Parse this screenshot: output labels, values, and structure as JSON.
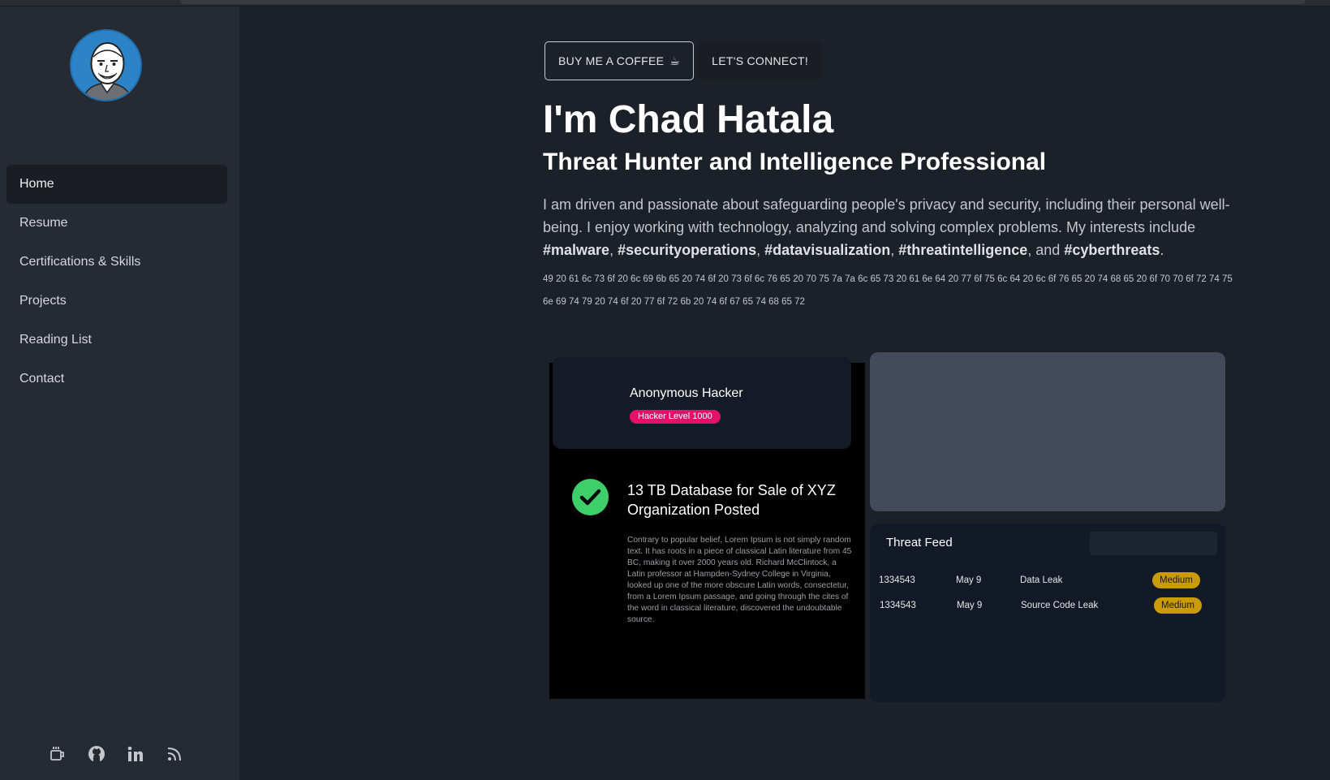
{
  "sidebar": {
    "nav": [
      {
        "label": "Home",
        "active": true
      },
      {
        "label": "Resume"
      },
      {
        "label": "Certifications & Skills"
      },
      {
        "label": "Projects"
      },
      {
        "label": "Reading List"
      },
      {
        "label": "Contact"
      }
    ],
    "social_icons": [
      "coffee-cup-icon",
      "github-icon",
      "linkedin-icon",
      "rss-icon"
    ]
  },
  "header": {
    "coffee_button": "BUY ME A COFFEE",
    "coffee_emoji": "☕",
    "connect_button": "LET'S CONNECT!"
  },
  "hero": {
    "name": "I'm Chad Hatala",
    "role": "Threat Hunter and Intelligence Professional",
    "bio_text": "I am driven and passionate about safeguarding people's privacy and security, including their personal well-being. I enjoy working with technology, analyzing and solving complex problems. My interests include",
    "tags": [
      "#malware",
      "#securityoperations",
      "#datavisualization",
      "#threatintelligence",
      "#cyberthreats"
    ],
    "tag_sep": ", ",
    "tag_and": ", and ",
    "tag_end": ".",
    "hex": "49 20 61 6c 73 6f 20 6c 69 6b 65 20 74 6f 20 73 6f 6c 76 65 20 70 75 7a 7a 6c 65 73 20 61 6e 64 20 77 6f 75 6c 64 20 6c 6f 76 65 20 74 68 65 20 6f 70 70 6f 72 74 75 6e 69 74 79 20 74 6f 20 77 6f 72 6b 20 74 6f 67 65 74 68 65 72"
  },
  "hacker_card": {
    "name": "Anonymous Hacker",
    "badge": "Hacker Level 1000",
    "badge_color": "#e3116c"
  },
  "post": {
    "title": "13 TB Database for Sale of XYZ Organization Posted",
    "body": "Contrary to popular belief, Lorem Ipsum is not simply random text. It has roots in a piece of classical Latin literature from 45 BC, making it over 2000 years old. Richard McClintock, a Latin professor at Hampden-Sydney College in Virginia, looked up one of the more obscure Latin words, consectetur, from a Lorem Ipsum passage, and going through the cites of the word in classical literature, discovered the undoubtable source.",
    "status_icon": "check-circle-icon",
    "status_color": "#3ecf6a"
  },
  "threat_feed": {
    "title": "Threat Feed",
    "rows": [
      {
        "id": "1334543",
        "date": "May 9",
        "type": "Data Leak",
        "severity": "Medium"
      },
      {
        "id": "1334543",
        "date": "May 9",
        "type": "Source Code Leak",
        "severity": "Medium"
      }
    ],
    "severity_color": "#c99b06"
  }
}
